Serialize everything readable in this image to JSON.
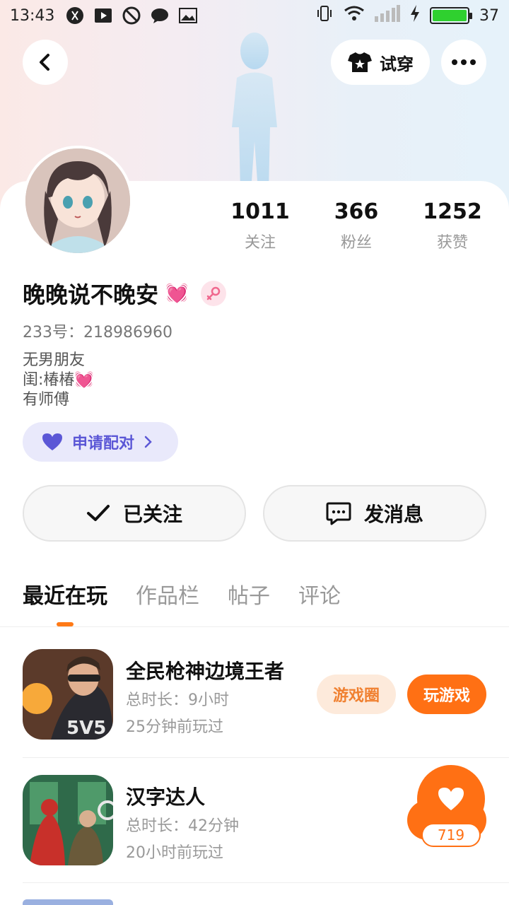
{
  "status_bar": {
    "time": "13:43",
    "battery": "37"
  },
  "top_nav": {
    "try_on_label": "试穿"
  },
  "stats": [
    {
      "value": "1011",
      "label": "关注"
    },
    {
      "value": "366",
      "label": "粉丝"
    },
    {
      "value": "1252",
      "label": "获赞"
    }
  ],
  "profile": {
    "nickname": "晚晚说不晚安",
    "nickname_emoji": "💓",
    "gender": "female",
    "uid": "233号：218986960",
    "bio_lines": [
      "无男朋友",
      "闺:椿椿💓",
      "有师傅"
    ]
  },
  "match_button": {
    "label": "申请配对"
  },
  "actions": {
    "follow_label": "已关注",
    "message_label": "发消息"
  },
  "tabs": [
    "最近在玩",
    "作品栏",
    "帖子",
    "评论"
  ],
  "games": [
    {
      "name": "全民枪神边境王者",
      "duration": "总时长：9小时",
      "last_played": "25分钟前玩过",
      "circle_label": "游戏圈",
      "play_label": "玩游戏"
    },
    {
      "name": "汉字达人",
      "duration": "总时长：42分钟",
      "last_played": "20小时前玩过"
    }
  ],
  "like": {
    "count": "719"
  },
  "colors": {
    "accent": "#ff7014",
    "match": "#5b57d6",
    "female": "#f0688e"
  }
}
